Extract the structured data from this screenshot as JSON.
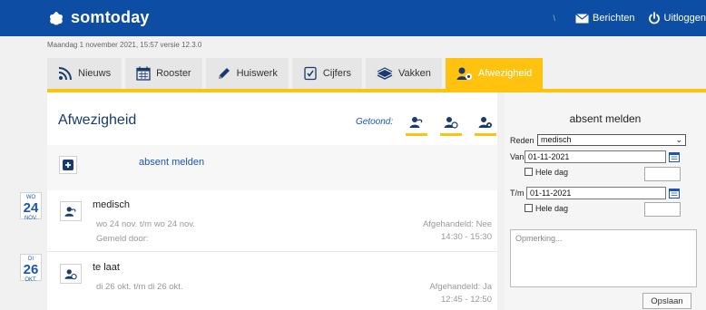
{
  "header": {
    "app_name": "somtoday",
    "separator": "\\",
    "messages_label": "Berichten",
    "logout_label": "Uitloggen"
  },
  "version_line": "Maandag 1 november 2021, 15:57 versie 12.3.0",
  "tabs": [
    {
      "label": "Nieuws",
      "icon": "rss-icon",
      "active": false
    },
    {
      "label": "Rooster",
      "icon": "calendar-icon",
      "active": false
    },
    {
      "label": "Huiswerk",
      "icon": "pencil-icon",
      "active": false
    },
    {
      "label": "Cijfers",
      "icon": "grades-icon",
      "active": false
    },
    {
      "label": "Vakken",
      "icon": "books-icon",
      "active": false
    },
    {
      "label": "Afwezigheid",
      "icon": "absence-icon",
      "active": true
    }
  ],
  "main": {
    "title": "Afwezigheid",
    "shown_label": "Getoond:",
    "add_label": "absent melden",
    "records": [
      {
        "weekday": "WO",
        "day": "24",
        "month": "NOV.",
        "title": "medisch",
        "period": "wo 24 nov. t/m wo 24 nov.",
        "reported_by": "Gemeld door:",
        "handled": "Afgehandeld: Nee",
        "time": "14:30 - 15:30"
      },
      {
        "weekday": "DI",
        "day": "26",
        "month": "OKT.",
        "title": "te laat",
        "period": "di 26 okt. t/m di 26 okt.",
        "reported_by": "",
        "handled": "Afgehandeld: Ja",
        "time": "12:45 - 12:50"
      }
    ]
  },
  "form": {
    "title": "absent melden",
    "reason_label": "Reden",
    "reason_value": "medisch",
    "from_label": "Van",
    "from_value": "01-11-2021",
    "to_label": "T/m",
    "to_value": "01-11-2021",
    "all_day_label": "Hele dag",
    "remark_placeholder": "Opmerking...",
    "save_label": "Opslaan"
  },
  "colors": {
    "brand_blue": "#0e4da4",
    "accent_yellow": "#ffc20e",
    "link_blue": "#1a56b0"
  }
}
